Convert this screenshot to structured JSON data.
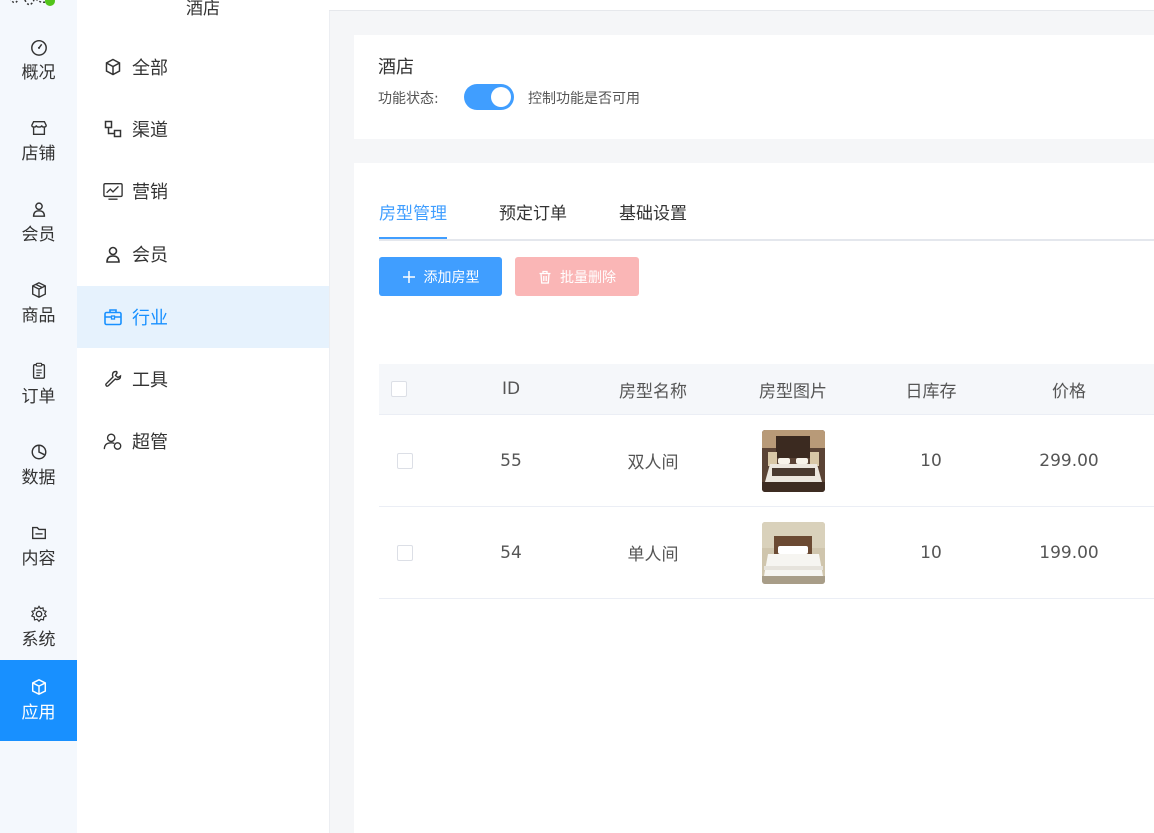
{
  "rail": {
    "items": [
      {
        "label": "概况",
        "icon": "dashboard-icon"
      },
      {
        "label": "店铺",
        "icon": "store-icon"
      },
      {
        "label": "会员",
        "icon": "user-icon"
      },
      {
        "label": "商品",
        "icon": "box-icon"
      },
      {
        "label": "订单",
        "icon": "clipboard-icon"
      },
      {
        "label": "数据",
        "icon": "pie-chart-icon"
      },
      {
        "label": "内容",
        "icon": "folder-icon"
      },
      {
        "label": "系统",
        "icon": "gear-icon"
      },
      {
        "label": "应用",
        "icon": "cube-icon",
        "active": true
      }
    ]
  },
  "submenu": {
    "title": "酒店",
    "items": [
      {
        "label": "全部",
        "icon": "cube-icon"
      },
      {
        "label": "渠道",
        "icon": "channel-icon"
      },
      {
        "label": "营销",
        "icon": "trend-monitor-icon"
      },
      {
        "label": "会员",
        "icon": "user-icon"
      },
      {
        "label": "行业",
        "icon": "briefcase-icon",
        "active": true
      },
      {
        "label": "工具",
        "icon": "wrench-icon"
      },
      {
        "label": "超管",
        "icon": "admin-user-icon"
      }
    ]
  },
  "plugin": {
    "title": "酒店",
    "status_label": "功能状态:",
    "enabled": true,
    "hint": "控制功能是否可用"
  },
  "tabs": [
    {
      "label": "房型管理",
      "active": true
    },
    {
      "label": "预定订单"
    },
    {
      "label": "基础设置"
    }
  ],
  "actions": {
    "add_label": "添加房型",
    "delete_label": "批量删除"
  },
  "table": {
    "columns": [
      "ID",
      "房型名称",
      "房型图片",
      "日库存",
      "价格"
    ],
    "rows": [
      {
        "id": "55",
        "name": "双人间",
        "image": "double-room-photo",
        "stock": "10",
        "price": "299.00"
      },
      {
        "id": "54",
        "name": "单人间",
        "image": "single-room-photo",
        "stock": "10",
        "price": "199.00"
      }
    ]
  },
  "colors": {
    "primary": "#409eff",
    "rail_active": "#1890ff",
    "danger_disabled": "#fab6b6",
    "submenu_active_bg": "#e6f2fd"
  }
}
